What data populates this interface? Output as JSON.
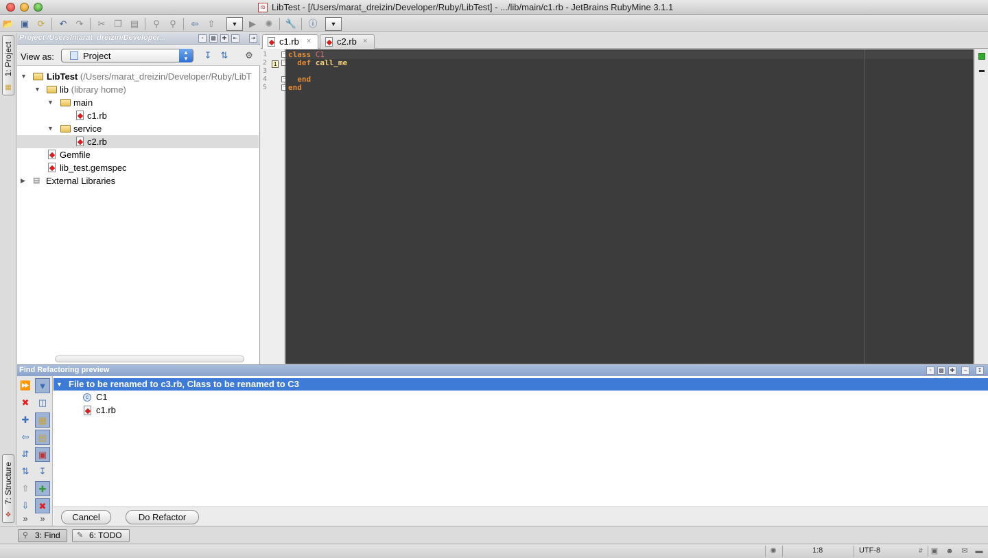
{
  "window": {
    "title": "LibTest - [/Users/marat_dreizin/Developer/Ruby/LibTest] - .../lib/main/c1.rb - JetBrains RubyMine 3.1.1",
    "file_badge": "rb"
  },
  "left_strip": {
    "project_tab": "1: Project",
    "structure_tab": "7: Structure"
  },
  "project_panel": {
    "header_title": "Project /Users/marat_dreizin/Developer...",
    "view_as_label": "View as:",
    "view_as_value": "Project",
    "tree": [
      {
        "name": "LibTest",
        "detail": "(/Users/marat_dreizin/Developer/Ruby/LibT",
        "kind": "folder"
      },
      {
        "name": "lib",
        "detail": "(library home)",
        "kind": "folder"
      },
      {
        "name": "main",
        "detail": "",
        "kind": "folder"
      },
      {
        "name": "c1.rb",
        "detail": "",
        "kind": "ruby-file"
      },
      {
        "name": "service",
        "detail": "",
        "kind": "folder"
      },
      {
        "name": "c2.rb",
        "detail": "",
        "kind": "ruby-file"
      },
      {
        "name": "Gemfile",
        "detail": "",
        "kind": "ruby-file"
      },
      {
        "name": "lib_test.gemspec",
        "detail": "",
        "kind": "ruby-file"
      },
      {
        "name": "External Libraries",
        "detail": "",
        "kind": "library"
      }
    ]
  },
  "editor": {
    "tabs": [
      {
        "label": "c1.rb",
        "close": "×"
      },
      {
        "label": "c2.rb",
        "close": "×"
      }
    ],
    "line_numbers": [
      "1",
      "2",
      "3",
      "4",
      "5"
    ],
    "gutter_marker": "1",
    "lines": {
      "l1_kw": "class",
      "l1_name": "C1",
      "l2_kw": "def",
      "l2_name": "call_me",
      "l4_kw": "end",
      "l5_kw": "end"
    }
  },
  "find_panel": {
    "header_title": "Find Refactoring preview",
    "group_label": "File to be renamed to c3.rb, Class to be renamed to C3",
    "items": [
      {
        "label": "C1",
        "kind": "class",
        "icon_letter": "c"
      },
      {
        "label": "c1.rb",
        "kind": "ruby-file"
      }
    ],
    "cancel_label": "Cancel",
    "refactor_label": "Do Refactor",
    "more_glyph": "»"
  },
  "bottom_tabs": [
    {
      "label": "3: Find"
    },
    {
      "label": "6: TODO"
    }
  ],
  "statusbar": {
    "position": "1:8",
    "encoding": "UTF-8"
  },
  "colors": {
    "editor_background": "#3c3c3c",
    "keyword": "#e08b3a",
    "class_name": "#e06c75",
    "method_name": "#f4d27a",
    "selection": "#3d7bd6"
  }
}
